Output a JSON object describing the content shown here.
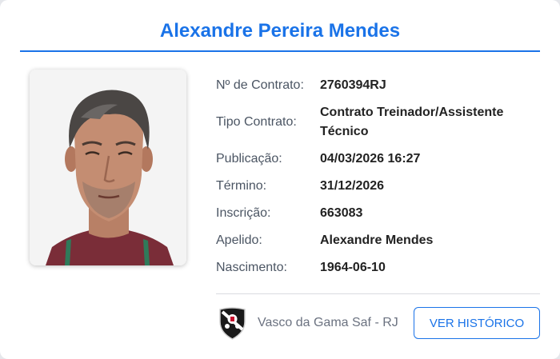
{
  "header": {
    "name": "Alexandre Pereira Mendes"
  },
  "details": [
    {
      "label": "Nº de Contrato:",
      "value": "2760394RJ"
    },
    {
      "label": "Tipo Contrato:",
      "value": "Contrato Treinador/Assistente Técnico"
    },
    {
      "label": "Publicação:",
      "value": "04/03/2026 16:27"
    },
    {
      "label": "Término:",
      "value": "31/12/2026"
    },
    {
      "label": "Inscrição:",
      "value": "663083"
    },
    {
      "label": "Apelido:",
      "value": "Alexandre Mendes"
    },
    {
      "label": "Nascimento:",
      "value": "1964-06-10"
    }
  ],
  "club": {
    "name": "Vasco da Gama Saf - RJ",
    "logo_icon": "vasco-crest-icon"
  },
  "actions": {
    "history_button": "VER HISTÓRICO"
  },
  "colors": {
    "accent": "#1a73e8",
    "label_text": "#4b5563",
    "value_text": "#222222",
    "club_text": "#6b7280"
  }
}
